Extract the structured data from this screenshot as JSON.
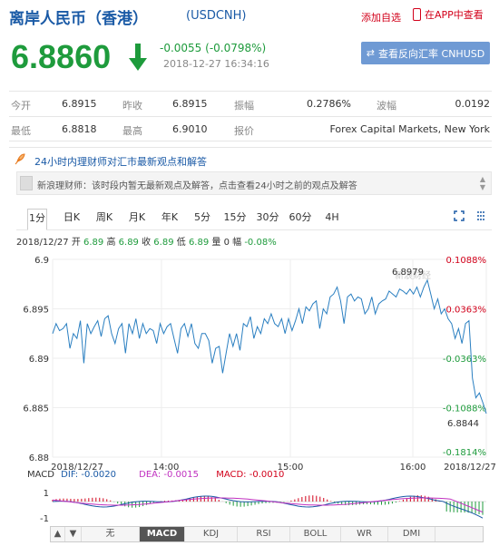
{
  "header": {
    "title": "离岸人民币（香港）",
    "code": "(USDCNH)",
    "add_favorite": "添加自选",
    "app_link": "在APP中查看"
  },
  "quote": {
    "price": "6.8860",
    "change": "-0.0055 (-0.0798%)",
    "timestamp": "2018-12-27 16:34:16",
    "reverse_button": "查看反向汇率 CNHUSD",
    "color_down": "#1e9b3c"
  },
  "stats": {
    "open_label": "今开",
    "open": "6.8915",
    "prev_close_label": "昨收",
    "prev_close": "6.8915",
    "amplitude_label": "振幅",
    "amplitude": "0.2786%",
    "wave_label": "波幅",
    "wave": "0.0192",
    "low_label": "最低",
    "low": "6.8818",
    "high_label": "最高",
    "high": "6.9010",
    "quote_label": "报价",
    "quote_source": "Forex Capital Markets, New York"
  },
  "opinion": {
    "title": "24小时内理财师对汇市最新观点和解答",
    "notice": "新浪理财师：该时段内暂无最新观点及解答，点击查看24小时之前的观点及解答"
  },
  "tabs": [
    "1分",
    "日K",
    "周K",
    "月K",
    "年K",
    "5分",
    "15分",
    "30分",
    "60分",
    "4H"
  ],
  "info_line": {
    "date": "2018/12/27",
    "open_label": "开",
    "open": "6.89",
    "high_label": "高",
    "high": "6.89",
    "close_label": "收",
    "close": "6.89",
    "low_label": "低",
    "low": "6.89",
    "volume_label": "量",
    "volume": "0",
    "amp_label": "幅",
    "amp": "-0.08%"
  },
  "chart_data": {
    "type": "line",
    "y_ticks": [
      "6.9",
      "6.895",
      "6.89",
      "6.885",
      "6.88"
    ],
    "y_values": [
      6.9,
      6.895,
      6.89,
      6.885,
      6.88
    ],
    "ylim": [
      6.88,
      6.9
    ],
    "right_ticks": [
      "0.1088%",
      "0.0363%",
      "-0.0363%",
      "-0.1088%",
      "-0.1814%"
    ],
    "x_labels": [
      "2018/12/27",
      "14:00",
      "15:00",
      "16:00",
      "2018/12/27"
    ],
    "annotations": {
      "high": "6.8979",
      "last": "6.8844"
    },
    "watermark": "新浪财经",
    "series": [
      {
        "values": [
          6.8925,
          6.8935,
          6.8928,
          6.893,
          6.8935,
          6.891,
          6.8925,
          6.892,
          6.8938,
          6.8895,
          6.8935,
          6.8925,
          6.8932,
          6.8938,
          6.8922,
          6.894,
          6.8943,
          6.8925,
          6.8915,
          6.893,
          6.8935,
          6.8905,
          6.8935,
          6.8925,
          6.894,
          6.892,
          6.8935,
          6.8925,
          6.893,
          6.8928,
          6.8915,
          6.8935,
          6.8925,
          6.8932,
          6.8935,
          6.892,
          6.8905,
          6.893,
          6.8935,
          6.8922,
          6.8935,
          6.8915,
          6.891,
          6.8925,
          6.8925,
          6.8918,
          6.8895,
          6.891,
          6.8912,
          6.8885,
          6.8905,
          6.8925,
          6.8912,
          6.8925,
          6.8908,
          6.8935,
          6.8932,
          6.8942,
          6.892,
          6.8932,
          6.8925,
          6.894,
          6.8935,
          6.8945,
          6.8935,
          6.8932,
          6.894,
          6.8925,
          6.894,
          6.8928,
          6.8938,
          6.895,
          6.8935,
          6.8952,
          6.8948,
          6.8955,
          6.8958,
          6.893,
          6.895,
          6.8945,
          6.8962,
          6.8965,
          6.8972,
          6.8958,
          6.8935,
          6.8962,
          6.8965,
          6.8958,
          6.8962,
          6.896,
          6.8945,
          6.895,
          6.8962,
          6.8945,
          6.8955,
          6.8958,
          6.896,
          6.8968,
          6.8965,
          6.8962,
          6.897,
          6.8968,
          6.8965,
          6.897,
          6.8965,
          6.8972,
          6.8962,
          6.8972,
          6.8979,
          6.8965,
          6.895,
          6.896,
          6.8945,
          6.895,
          6.894,
          6.8935,
          6.892,
          6.893,
          6.8915,
          6.8935,
          6.8938,
          6.888,
          6.886,
          6.8865,
          6.8855,
          6.8844
        ]
      }
    ]
  },
  "macd": {
    "label": "MACD",
    "dif_label": "DIF:",
    "dif": "-0.0020",
    "dea_label": "DEA:",
    "dea": "-0.0015",
    "macd_label": "MACD:",
    "macd": "-0.0010",
    "y_ticks": [
      "1",
      "-1"
    ]
  },
  "bottom_tabs": [
    "无",
    "MACD",
    "KDJ",
    "RSI",
    "BOLL",
    "WR",
    "DMI"
  ]
}
